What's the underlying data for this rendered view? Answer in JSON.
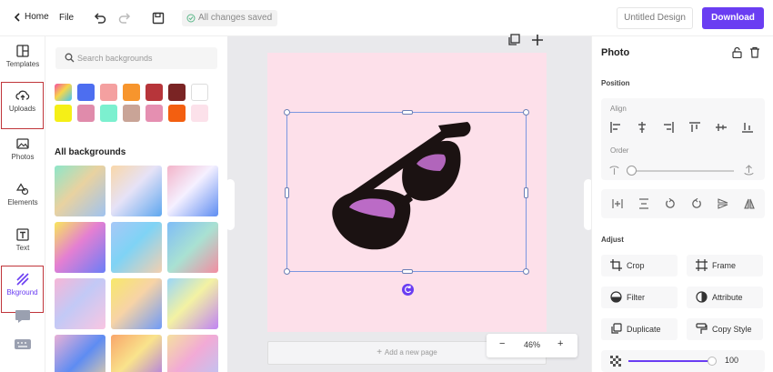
{
  "topbar": {
    "home_label": "Home",
    "file_label": "File",
    "saved_status": "All changes saved",
    "design_title": "Untitled Design",
    "download_label": "Download"
  },
  "rail": {
    "items": [
      {
        "label": "Templates",
        "icon": "templates-icon"
      },
      {
        "label": "Uploads",
        "icon": "upload-icon"
      },
      {
        "label": "Photos",
        "icon": "photo-icon"
      },
      {
        "label": "Elements",
        "icon": "elements-icon"
      },
      {
        "label": "Text",
        "icon": "text-icon"
      },
      {
        "label": "Bkground",
        "icon": "background-icon"
      }
    ]
  },
  "backgrounds": {
    "search_placeholder": "Search backgrounds",
    "section_title": "All backgrounds",
    "swatches": [
      "gradient",
      "#4d6ef0",
      "#f4a0a0",
      "#f7952d",
      "#b7353a",
      "#7a2424",
      "#ffffff",
      "#f5ef17",
      "#e08bab",
      "#7cf0cf",
      "#c9a497",
      "#e58fb1",
      "#f35f10",
      "#fce1ea"
    ],
    "tiles": [
      "linear-gradient(135deg,#8ee6c9,#e9d2a0 45%,#9fc3f0)",
      "linear-gradient(135deg,#f9d7a9,#e6e2f7 45%,#5fa7ef)",
      "linear-gradient(135deg,#f3b4c9,#f5f0ff 45%,#5e8df2)",
      "linear-gradient(135deg,#f8e65c,#e47fd2 45%,#6b7ef7)",
      "linear-gradient(135deg,#a7c8f7,#7fd3f5 45%,#f3d0b0)",
      "linear-gradient(135deg,#7fbdf7,#a9e1d2 50%,#f38da1)",
      "linear-gradient(135deg,#f6b6d7,#c2c9f6 45%,#f9c6e2)",
      "linear-gradient(135deg,#f7e86a,#f7d3a6 45%,#6f9bf7)",
      "linear-gradient(135deg,#9ad6f7,#f3f2a3 45%,#c084f4)",
      "linear-gradient(135deg,#e9b1d6,#5e8cf2 50%,#f1d5a0)",
      "linear-gradient(135deg,#f9a66a,#f9e38c 45%,#a56ef0)",
      "linear-gradient(135deg,#f5e0a0,#f2aad5 45%,#b7c8f7)"
    ]
  },
  "canvas": {
    "add_page_label": "Add a new page",
    "zoom_value": "46%"
  },
  "properties": {
    "title": "Photo",
    "position_label": "Position",
    "align_label": "Align",
    "order_label": "Order",
    "adjust_label": "Adjust",
    "buttons": [
      {
        "label": "Crop",
        "icon": "crop-icon"
      },
      {
        "label": "Frame",
        "icon": "frame-icon"
      },
      {
        "label": "Filter",
        "icon": "filter-icon"
      },
      {
        "label": "Attribute",
        "icon": "attribute-icon"
      },
      {
        "label": "Duplicate",
        "icon": "duplicate-icon"
      },
      {
        "label": "Copy Style",
        "icon": "copy-style-icon"
      }
    ],
    "opacity_value": "100",
    "opacity_fraction": 1.0,
    "order_fraction": 0.0
  },
  "colors": {
    "accent": "#6a3df2",
    "highlight": "#c0353a",
    "artboard": "#fde0ea"
  }
}
